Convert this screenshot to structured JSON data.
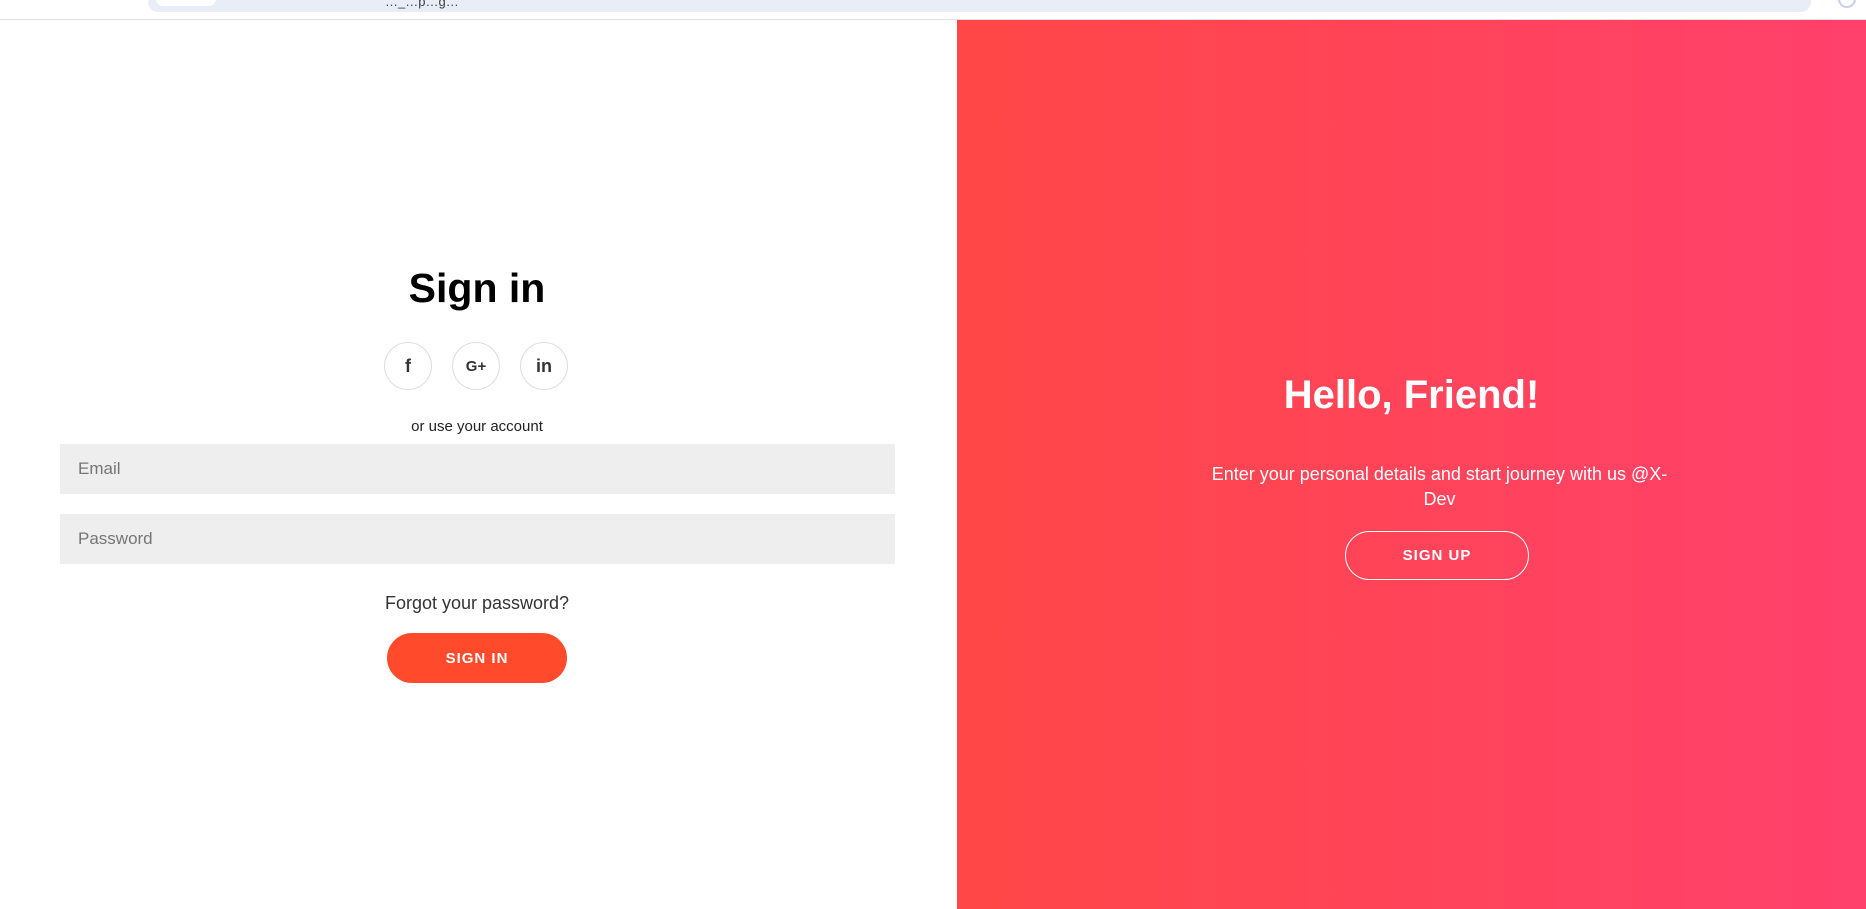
{
  "browser": {
    "address_text": "…_…p…g…"
  },
  "signin": {
    "title": "Sign in",
    "social": [
      {
        "icon": "facebook-icon",
        "glyph": "f"
      },
      {
        "icon": "google-plus-icon",
        "glyph": "G+"
      },
      {
        "icon": "linkedin-icon",
        "glyph": "in"
      }
    ],
    "subtext": "or use your account",
    "email_placeholder": "Email",
    "password_placeholder": "Password",
    "forgot_label": "Forgot your password?",
    "button_label": "SIGN IN",
    "button_color": "#ff4b2b"
  },
  "overlay": {
    "title": "Hello, Friend!",
    "text": "Enter your personal details and start journey with us @X-Dev",
    "button_label": "SIGN UP",
    "gradient_start": "#ff4747",
    "gradient_end": "#ff416c"
  }
}
